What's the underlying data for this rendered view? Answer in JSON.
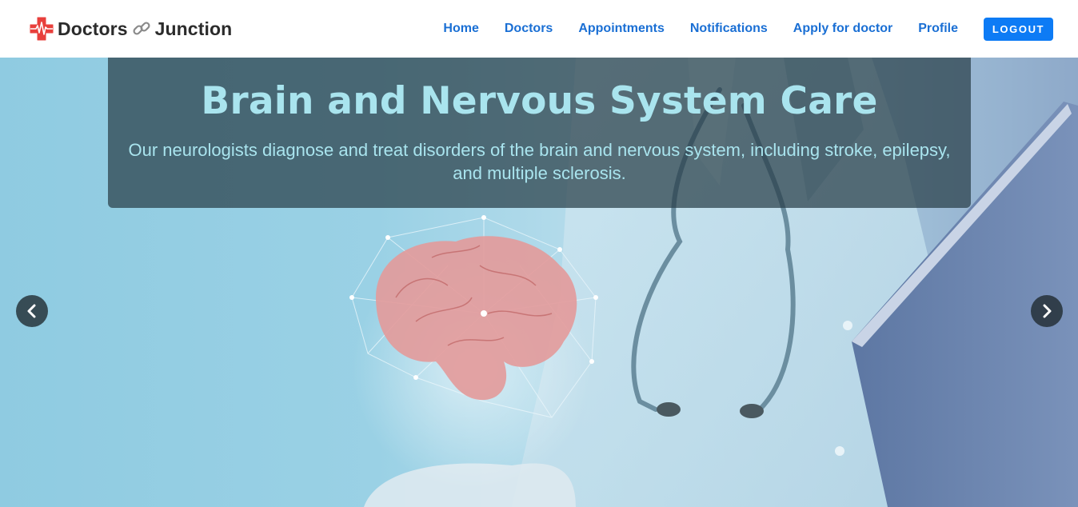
{
  "navbar": {
    "brand_left": "Doctors",
    "brand_right": "Junction",
    "links": {
      "home": "Home",
      "doctors": "Doctors",
      "appointments": "Appointments",
      "notifications": "Notifications",
      "apply": "Apply for doctor",
      "profile": "Profile"
    },
    "logout_label": "LOGOUT"
  },
  "hero": {
    "title": "Brain and Nervous System Care",
    "text": "Our neurologists diagnose and treat disorders of the brain and nervous system, including stroke, epilepsy, and multiple sclerosis."
  },
  "icons": {
    "logo": "medical-cross-icon",
    "link": "link-icon",
    "prev": "chevron-left-icon",
    "next": "chevron-right-icon"
  },
  "colors": {
    "nav_link": "#1a6fd4",
    "logout_bg": "#0d7bf5",
    "caption_text": "#a9e4ee",
    "logo_red": "#e8403c"
  }
}
